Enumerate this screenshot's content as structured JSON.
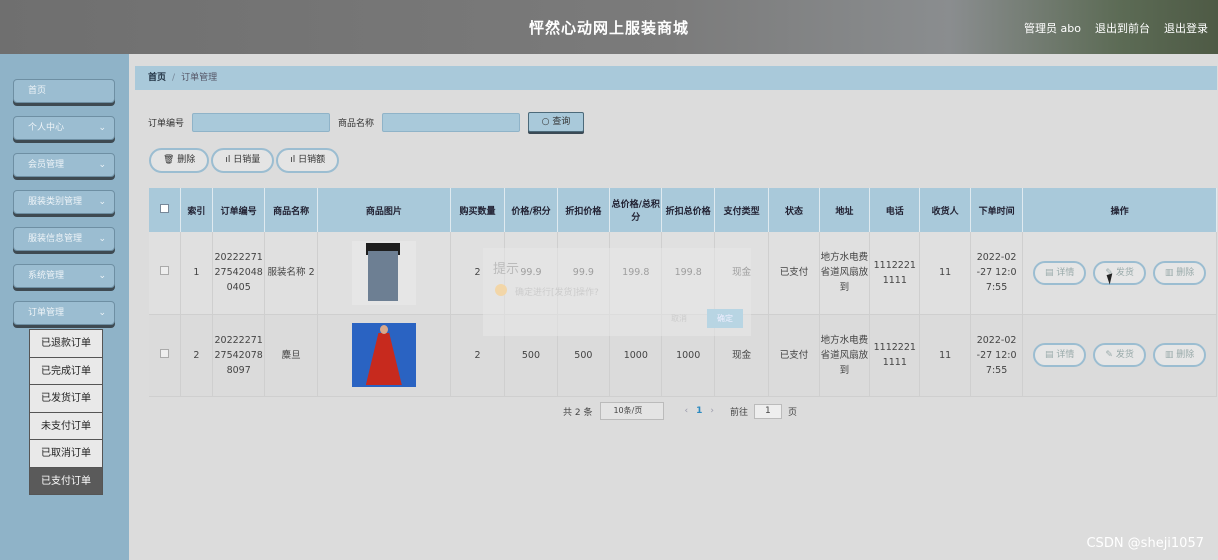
{
  "header": {
    "title": "怦然心动网上服装商城",
    "admin_label": "管理员 abo",
    "to_front_label": "退出到前台",
    "logout_label": "退出登录"
  },
  "sidebar": {
    "items": [
      {
        "label": "首页",
        "chevron": ""
      },
      {
        "label": "个人中心",
        "chevron": "⌄"
      },
      {
        "label": "会员管理",
        "chevron": "⌄"
      },
      {
        "label": "服装类别管理",
        "chevron": "⌄"
      },
      {
        "label": "服装信息管理",
        "chevron": "⌄"
      },
      {
        "label": "系统管理",
        "chevron": "⌄"
      },
      {
        "label": "订单管理",
        "chevron": "⌄"
      }
    ],
    "submenu": [
      "已退款订单",
      "已完成订单",
      "已发货订单",
      "未支付订单",
      "已取消订单",
      "已支付订单"
    ]
  },
  "breadcrumb": {
    "home": "首页",
    "current": "订单管理"
  },
  "search": {
    "order_no_label": "订单编号",
    "order_no_placeholder": "订单编号",
    "product_label": "商品名称",
    "product_placeholder": "商品名称",
    "query_label": "查询"
  },
  "actions": {
    "delete_label": "删除",
    "daily_sales_qty_label": "日销量",
    "daily_sales_amt_label": "日销额"
  },
  "table": {
    "headers": [
      "索引",
      "订单编号",
      "商品名称",
      "商品图片",
      "购买数量",
      "价格/积分",
      "折扣价格",
      "总价格/总积分",
      "折扣总价格",
      "支付类型",
      "状态",
      "地址",
      "电话",
      "收货人",
      "下单时间",
      "操作"
    ],
    "rows": [
      {
        "index": "1",
        "order_no": "20222271 27542048 0405",
        "name": "服装名称 2",
        "image": "jeans-photo",
        "qty": "2",
        "price": "99.9",
        "discount": "99.9",
        "total": "199.8",
        "discount_total": "199.8",
        "pay_type": "现金",
        "status": "已支付",
        "address": "地方水电费省道风扇放到",
        "phone": "1112221 1111",
        "receiver": "11",
        "time": "2022-02 -27 12:0 7:55"
      },
      {
        "index": "2",
        "order_no": "20222271 27542078 8097",
        "name": "麋旦",
        "image": "red-dress-photo",
        "qty": "2",
        "price": "500",
        "discount": "500",
        "total": "1000",
        "discount_total": "1000",
        "pay_type": "现金",
        "status": "已支付",
        "address": "地方水电费省道风扇放到",
        "phone": "1112221 1111",
        "receiver": "11",
        "time": "2022-02 -27 12:0 7:55"
      }
    ],
    "op_labels": {
      "detail": "详情",
      "ship": "发货",
      "delete": "删除"
    }
  },
  "modal": {
    "title": "提示",
    "message": "确定进行[发货]操作?",
    "cancel": "取消",
    "confirm": "确定"
  },
  "pager": {
    "total": "共 2 条",
    "page_size": "10条/页",
    "prev": "‹",
    "current": "1",
    "next": "›",
    "goto_label": "前往",
    "goto_value": "1",
    "page_suffix": "页"
  },
  "watermark": "CSDN @sheji1057",
  "colors": {
    "sidebar": "#8fb3c8",
    "accent": "#a9c9da",
    "active_submenu": "#5a5a5a"
  }
}
